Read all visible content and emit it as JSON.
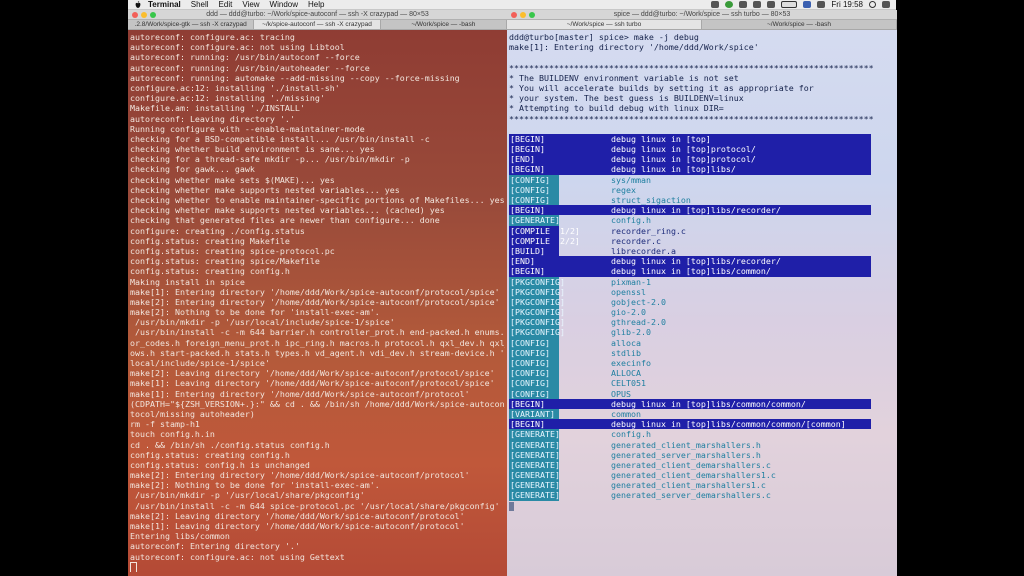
{
  "menubar": {
    "app": "Terminal",
    "items": [
      "Shell",
      "Edit",
      "View",
      "Window",
      "Help"
    ],
    "clock": "Fri 19:58"
  },
  "left_window": {
    "title": "ddd — ddd@turbo: ~/Work/spice-autoconf — ssh -X crazypad — 80×53",
    "tabs": [
      ".2.8/Work/spice-gtk — ssh -X crazypad",
      "~/k/spice-autoconf — ssh -X crazypad",
      "~/Work/spice — -bash"
    ],
    "lines": [
      "autoreconf: configure.ac: tracing",
      "autoreconf: configure.ac: not using Libtool",
      "autoreconf: running: /usr/bin/autoconf --force",
      "autoreconf: running: /usr/bin/autoheader --force",
      "autoreconf: running: automake --add-missing --copy --force-missing",
      "configure.ac:12: installing './install-sh'",
      "configure.ac:12: installing './missing'",
      "Makefile.am: installing './INSTALL'",
      "autoreconf: Leaving directory '.'",
      "Running configure with --enable-maintainer-mode",
      "checking for a BSD-compatible install... /usr/bin/install -c",
      "checking whether build environment is sane... yes",
      "checking for a thread-safe mkdir -p... /usr/bin/mkdir -p",
      "checking for gawk... gawk",
      "checking whether make sets $(MAKE)... yes",
      "checking whether make supports nested variables... yes",
      "checking whether to enable maintainer-specific portions of Makefiles... yes",
      "checking whether make supports nested variables... (cached) yes",
      "checking that generated files are newer than configure... done",
      "configure: creating ./config.status",
      "config.status: creating Makefile",
      "config.status: creating spice-protocol.pc",
      "config.status: creating spice/Makefile",
      "config.status: creating config.h",
      "Making install in spice",
      "make[1]: Entering directory '/home/ddd/Work/spice-autoconf/protocol/spice'",
      "make[2]: Entering directory '/home/ddd/Work/spice-autoconf/protocol/spice'",
      "make[2]: Nothing to be done for 'install-exec-am'.",
      " /usr/bin/mkdir -p '/usr/local/include/spice-1/spice'",
      " /usr/bin/install -c -m 644 barrier.h controller_prot.h end-packed.h enums.h er",
      "or_codes.h foreign_menu_prot.h ipc_ring.h macros.h protocol.h qxl_dev.h qxl_wi",
      "ows.h start-packed.h stats.h types.h vd_agent.h vdi_dev.h stream-device.h '/us",
      "local/include/spice-1/spice'",
      "make[2]: Leaving directory '/home/ddd/Work/spice-autoconf/protocol/spice'",
      "make[1]: Leaving directory '/home/ddd/Work/spice-autoconf/protocol/spice'",
      "make[1]: Entering directory '/home/ddd/Work/spice-autoconf/protocol'",
      "(CDPATH=\"${ZSH_VERSION+.}:\" && cd . && /bin/sh /home/ddd/Work/spice-autoconf/p",
      "tocol/missing autoheader)",
      "rm -f stamp-h1",
      "touch config.h.in",
      "cd . && /bin/sh ./config.status config.h",
      "config.status: creating config.h",
      "config.status: config.h is unchanged",
      "make[2]: Entering directory '/home/ddd/Work/spice-autoconf/protocol'",
      "make[2]: Nothing to be done for 'install-exec-am'.",
      " /usr/bin/mkdir -p '/usr/local/share/pkgconfig'",
      " /usr/bin/install -c -m 644 spice-protocol.pc '/usr/local/share/pkgconfig'",
      "make[2]: Leaving directory '/home/ddd/Work/spice-autoconf/protocol'",
      "make[1]: Leaving directory '/home/ddd/Work/spice-autoconf/protocol'",
      "Entering libs/common",
      "autoreconf: Entering directory '.'",
      "autoreconf: configure.ac: not using Gettext"
    ]
  },
  "right_window": {
    "title": "spice — ddd@turbo: ~/Work/spice — ssh turbo — 80×53",
    "tabs": [
      "~/Work/spice — ssh turbo",
      "~/Work/spice — -bash"
    ],
    "prompt": "ddd@turbo[master] spice> make -j debug",
    "intro": "make[1]: Entering directory '/home/ddd/Work/spice'",
    "stars": "*************************************************************************",
    "warning": [
      "* The BUILDENV environment variable is not set",
      "* You will accelerate builds by setting it as appropriate for",
      "* your system. The best guess is BUILDENV=linux",
      "* Attempting to build debug with linux DIR="
    ],
    "rows": [
      {
        "tag": "[BEGIN]",
        "msg": "debug linux in [top]",
        "style": "blue"
      },
      {
        "tag": "[BEGIN]",
        "msg": "debug linux in [top]protocol/",
        "style": "blue"
      },
      {
        "tag": "[END]",
        "msg": "debug linux in [top]protocol/",
        "style": "blue"
      },
      {
        "tag": "[BEGIN]",
        "msg": "debug linux in [top]libs/",
        "style": "blue"
      },
      {
        "tag": "[CONFIG]",
        "msg": "sys/mman",
        "style": "cyan"
      },
      {
        "tag": "[CONFIG]",
        "msg": "regex",
        "style": "cyan"
      },
      {
        "tag": "[CONFIG]",
        "msg": "struct_sigaction",
        "style": "cyan"
      },
      {
        "tag": "[BEGIN]",
        "msg": "debug linux in [top]libs/recorder/",
        "style": "blue"
      },
      {
        "tag": "[GENERATE]",
        "msg": "config.h",
        "style": "cyan"
      },
      {
        "tag": "[COMPILE  1/2]",
        "msg": "recorder_ring.c",
        "style": "plain"
      },
      {
        "tag": "[COMPILE  2/2]",
        "msg": "recorder.c",
        "style": "plain"
      },
      {
        "tag": "[BUILD]",
        "msg": "librecorder.a",
        "style": "plain"
      },
      {
        "tag": "[END]",
        "msg": "debug linux in [top]libs/recorder/",
        "style": "blue"
      },
      {
        "tag": "[BEGIN]",
        "msg": "debug linux in [top]libs/common/",
        "style": "blue"
      },
      {
        "tag": "[PKGCONFIG]",
        "msg": "pixman-1",
        "style": "cyan"
      },
      {
        "tag": "[PKGCONFIG]",
        "msg": "openssl",
        "style": "cyan"
      },
      {
        "tag": "[PKGCONFIG]",
        "msg": "gobject-2.0",
        "style": "cyan"
      },
      {
        "tag": "[PKGCONFIG]",
        "msg": "gio-2.0",
        "style": "cyan"
      },
      {
        "tag": "[PKGCONFIG]",
        "msg": "gthread-2.0",
        "style": "cyan"
      },
      {
        "tag": "[PKGCONFIG]",
        "msg": "glib-2.0",
        "style": "cyan"
      },
      {
        "tag": "[CONFIG]",
        "msg": "alloca",
        "style": "cyan"
      },
      {
        "tag": "[CONFIG]",
        "msg": "stdlib",
        "style": "cyan"
      },
      {
        "tag": "[CONFIG]",
        "msg": "execinfo",
        "style": "cyan"
      },
      {
        "tag": "[CONFIG]",
        "msg": "ALLOCA",
        "style": "cyan"
      },
      {
        "tag": "[CONFIG]",
        "msg": "CELT051",
        "style": "cyan"
      },
      {
        "tag": "[CONFIG]",
        "msg": "OPUS",
        "style": "cyan"
      },
      {
        "tag": "[BEGIN]",
        "msg": "debug linux in [top]libs/common/common/",
        "style": "blue"
      },
      {
        "tag": "[VARIANT]",
        "msg": "common",
        "style": "cyan"
      },
      {
        "tag": "[BEGIN]",
        "msg": "debug linux in [top]libs/common/common/[common]",
        "style": "blue"
      },
      {
        "tag": "[GENERATE]",
        "msg": "config.h",
        "style": "cyan"
      },
      {
        "tag": "[GENERATE]",
        "msg": "generated_client_marshallers.h",
        "style": "cyan"
      },
      {
        "tag": "[GENERATE]",
        "msg": "generated_server_marshallers.h",
        "style": "cyan"
      },
      {
        "tag": "[GENERATE]",
        "msg": "generated_client_demarshallers.c",
        "style": "cyan"
      },
      {
        "tag": "[GENERATE]",
        "msg": "generated_client_demarshallers1.c",
        "style": "cyan"
      },
      {
        "tag": "[GENERATE]",
        "msg": "generated_client_marshallers1.c",
        "style": "cyan"
      },
      {
        "tag": "[GENERATE]",
        "msg": "generated_server_demarshallers.c",
        "style": "cyan"
      }
    ]
  },
  "colors": {
    "tag_blue": "#1f1fa8",
    "tag_cyan": "#2a8aa5",
    "warning_red": "#c02020"
  }
}
